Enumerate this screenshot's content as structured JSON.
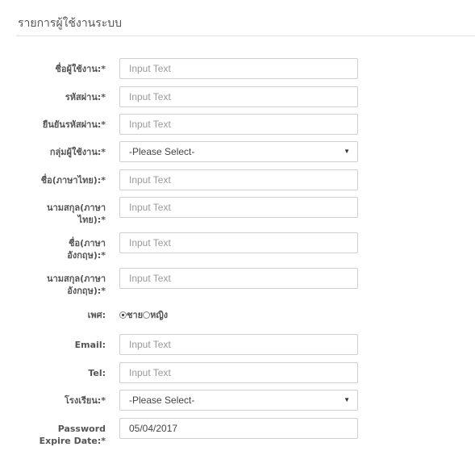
{
  "page": {
    "title": "รายการผู้ใช้งานระบบ"
  },
  "form": {
    "username": {
      "label": "ชื่อผู้ใช้งาน:*",
      "placeholder": "Input Text"
    },
    "password": {
      "label": "รหัสผ่าน:*",
      "placeholder": "Input Text"
    },
    "confirm_password": {
      "label": "ยืนยันรหัสผ่าน:*",
      "placeholder": "Input Text"
    },
    "user_group": {
      "label": "กลุ่มผู้ใช้งาน:*",
      "value": "-Please Select-"
    },
    "first_name_th": {
      "label": "ชื่อ(ภาษาไทย):*",
      "placeholder": "Input Text"
    },
    "last_name_th": {
      "label_line1": "นามสกุล(ภาษา",
      "label_line2": "ไทย):*",
      "placeholder": "Input Text"
    },
    "first_name_en": {
      "label_line1": "ชื่อ(ภาษา",
      "label_line2": "อังกฤษ):*",
      "placeholder": "Input Text"
    },
    "last_name_en": {
      "label_line1": "นามสกุล(ภาษา",
      "label_line2": "อังกฤษ):*",
      "placeholder": "Input Text"
    },
    "gender": {
      "label": "เพศ:",
      "options": [
        "ชาย",
        "หญิง"
      ],
      "selected": "ชาย"
    },
    "email": {
      "label": "Email:",
      "placeholder": "Input Text"
    },
    "tel": {
      "label": "Tel:",
      "placeholder": "Input Text"
    },
    "school": {
      "label": "โรงเรียน:*",
      "value": "-Please Select-"
    },
    "password_expire": {
      "label_line1": "Password",
      "label_line2": "Expire Date:*",
      "value": "05/04/2017"
    }
  }
}
